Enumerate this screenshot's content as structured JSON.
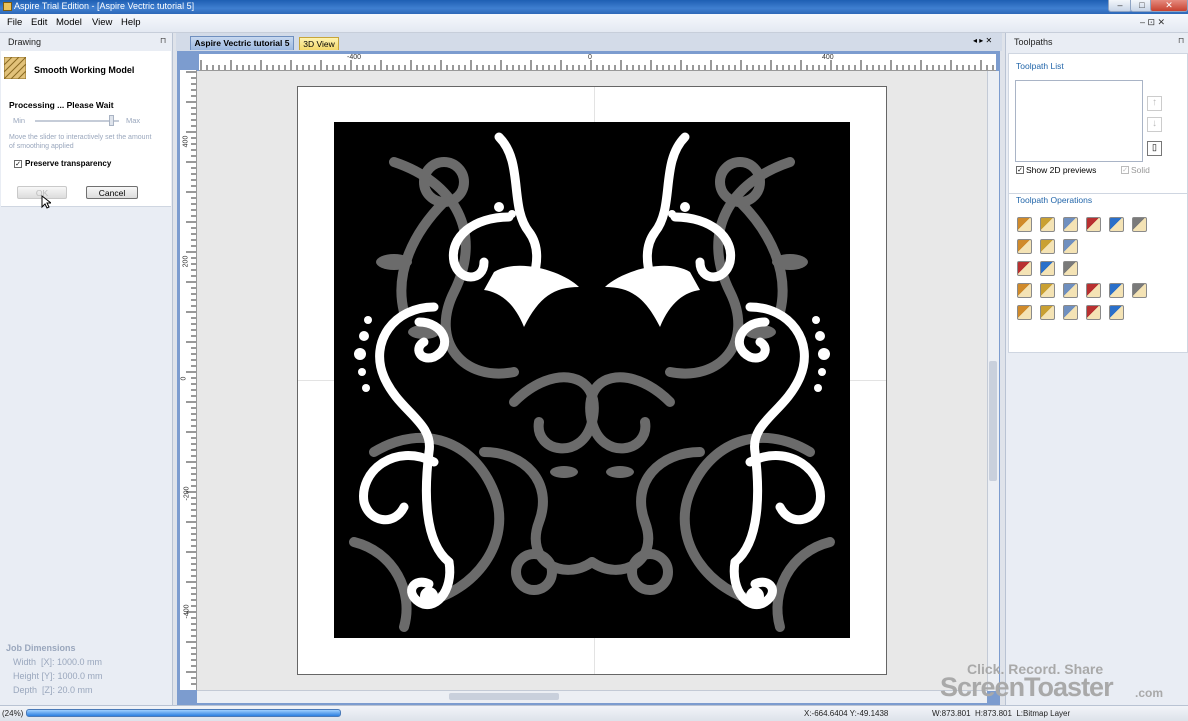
{
  "window": {
    "title": "Aspire Trial Edition - [Aspire Vectric tutorial 5]",
    "minimize": "–",
    "maximize": "□",
    "close": "✕"
  },
  "menubar": {
    "items": [
      "File",
      "Edit",
      "Model",
      "View",
      "Help"
    ],
    "mdi_controls": "–  ⊡  ✕"
  },
  "left_panel": {
    "title": "Drawing",
    "pin": "⊓",
    "tool_title": "Smooth Working Model",
    "status": "Processing ... Please Wait",
    "slider": {
      "min_label": "Min",
      "max_label": "Max",
      "value": 0.9
    },
    "help_text": "Move the slider to interactively set the amount of smoothing applied",
    "preserve_transparency": {
      "label": "Preserve transparency",
      "checked": true
    },
    "ok_label": "OK",
    "cancel_label": "Cancel",
    "job_dimensions": {
      "title": "Job Dimensions",
      "width": "Width  [X]: 1000.0 mm",
      "height": "Height [Y]: 1000.0 mm",
      "depth": "Depth  [Z]: 20.0 mm"
    }
  },
  "doc_tabs": {
    "active": "Aspire Vectric tutorial 5",
    "other": "3D View",
    "nav": "◂ ▸ ✕"
  },
  "rulers": {
    "horizontal": [
      "-400",
      "0",
      "400"
    ],
    "vertical": [
      "400",
      "200",
      "0",
      "-200",
      "-400"
    ]
  },
  "right_panel": {
    "title": "Toolpaths",
    "pin": "⊓",
    "toolpath_list_title": "Toolpath List",
    "show_2d_previews": {
      "label": "Show 2D previews",
      "checked": true
    },
    "solid": {
      "label": "Solid",
      "checked": true
    },
    "operations_title": "Toolpath Operations",
    "operation_icons": [
      [
        "profile-toolpath-icon",
        "pocket-toolpath-icon",
        "drilling-toolpath-icon",
        "vcarve-toolpath-icon",
        "prism-toolpath-icon",
        "fluting-toolpath-icon"
      ],
      [
        "moulding-toolpath-icon",
        "chamfer-toolpath-icon",
        "inlay-toolpath-icon"
      ],
      [
        "3d-roughing-icon",
        "3d-finishing-icon",
        "cut-out-icon"
      ],
      [
        "texture-toolpath-icon",
        "edit-toolpath-icon",
        "template-icon",
        "delete-toolpath-icon",
        "recalculate-icon",
        "save-toolpath-icon"
      ],
      [
        "preview-toolpath-icon",
        "zoom-toolpath-icon",
        "anchor-icon",
        "tabs-icon",
        "merge-icon"
      ]
    ],
    "colors": [
      "#d08a2a",
      "#c9a033",
      "#6f8fbf",
      "#b83030",
      "#2a6fc9",
      "#7a7a7a"
    ]
  },
  "status": {
    "zoom": "(24%)",
    "progress": 0.29,
    "coords": "X:-664.6404 Y:-49.1438",
    "dims": "W:873.801  H:873.801  L:Bitmap Layer"
  },
  "watermark": {
    "line1": "Click. Record. Share",
    "brand": "ScreenToaster",
    "suffix": ".com"
  }
}
